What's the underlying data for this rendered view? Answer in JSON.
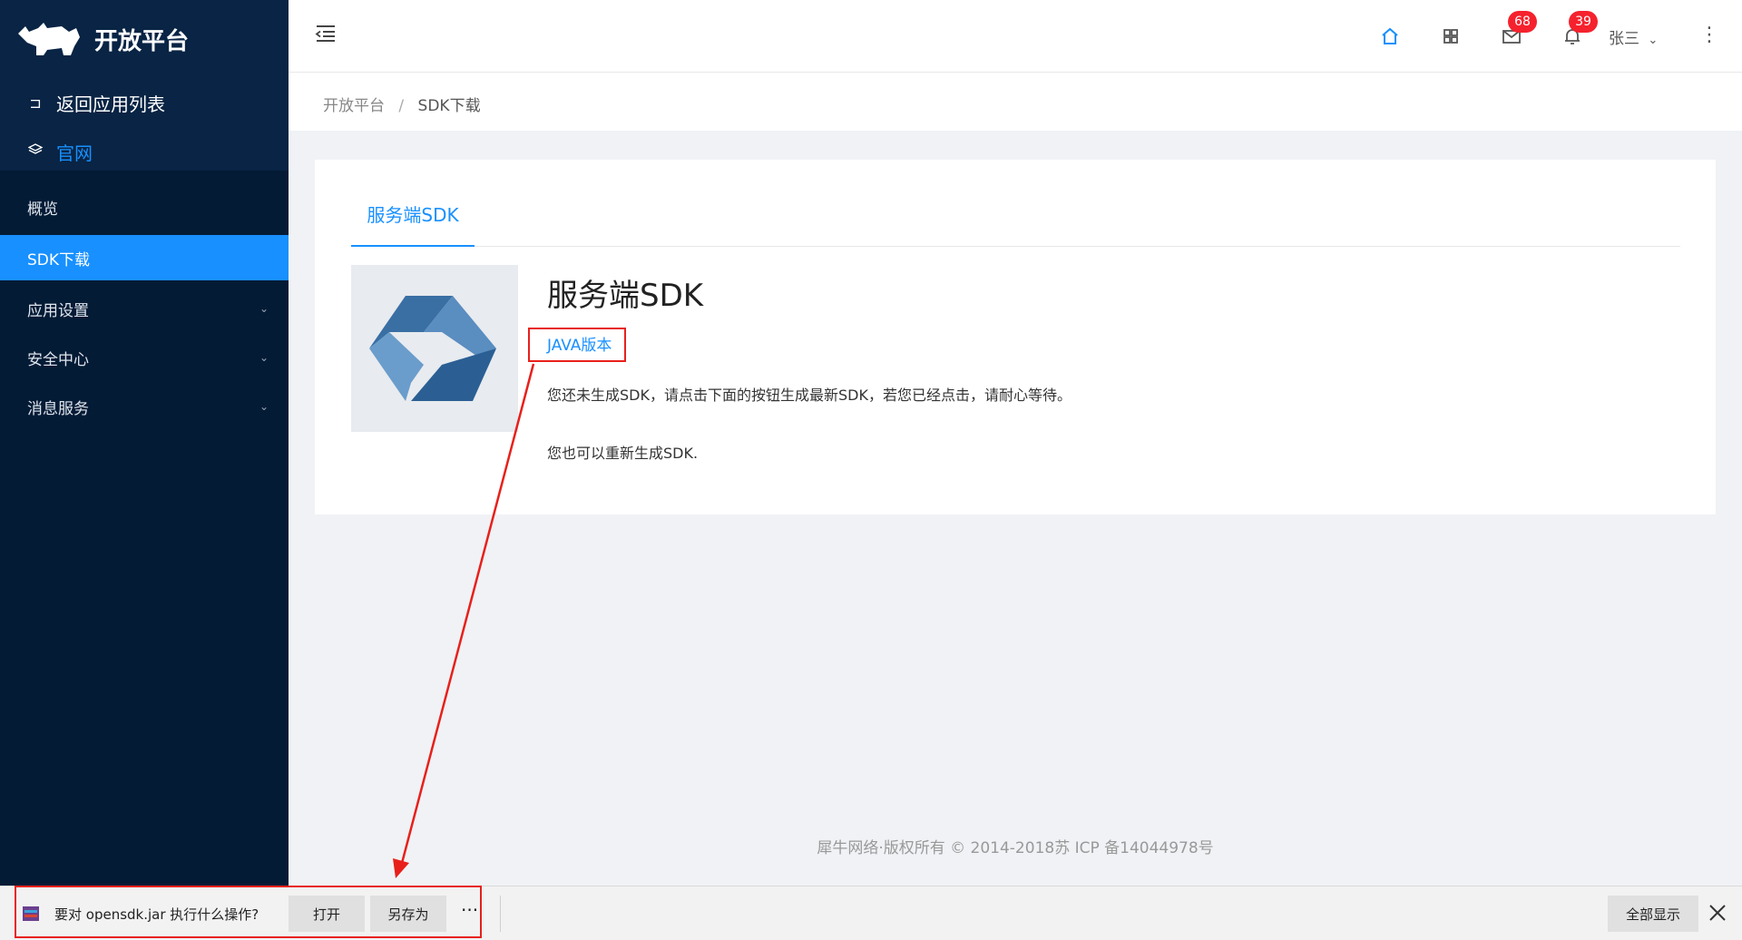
{
  "app": {
    "title": "开放平台"
  },
  "sidebar": {
    "back_label": "返回应用列表",
    "website_label": "官网",
    "items": [
      {
        "label": "概览"
      },
      {
        "label": "SDK下载"
      },
      {
        "label": "应用设置"
      },
      {
        "label": "安全中心"
      },
      {
        "label": "消息服务"
      }
    ]
  },
  "header": {
    "mail_count": "68",
    "bell_count": "39",
    "username": "张三"
  },
  "breadcrumb": {
    "root": "开放平台",
    "separator": "/",
    "current": "SDK下载"
  },
  "card": {
    "tab_label": "服务端SDK",
    "title": "服务端SDK",
    "java_link": "JAVA版本",
    "desc1": "您还未生成SDK，请点击下面的按钮生成最新SDK，若您已经点击，请耐心等待。",
    "desc2": "您也可以重新生成SDK."
  },
  "footer": {
    "text": "犀牛网络·版权所有 © 2014-2018苏 ICP 备14044978号"
  },
  "download_bar": {
    "prompt": "要对 opensdk.jar 执行什么操作?",
    "open_label": "打开",
    "save_as_label": "另存为",
    "more_label": "···",
    "show_all_label": "全部显示"
  },
  "colors": {
    "sidebar_bg": "#041b36",
    "accent": "#1890ff",
    "badge": "#f5222d",
    "annotation": "#e8201b"
  },
  "icons": [
    "rhino-logo",
    "back-icon",
    "layers-icon",
    "menu-toggle-icon",
    "home-icon",
    "apps-grid-icon",
    "mail-icon",
    "bell-icon",
    "chevron-down-icon",
    "more-vertical-icon",
    "sdk-logo",
    "jar-file-icon",
    "close-icon"
  ]
}
